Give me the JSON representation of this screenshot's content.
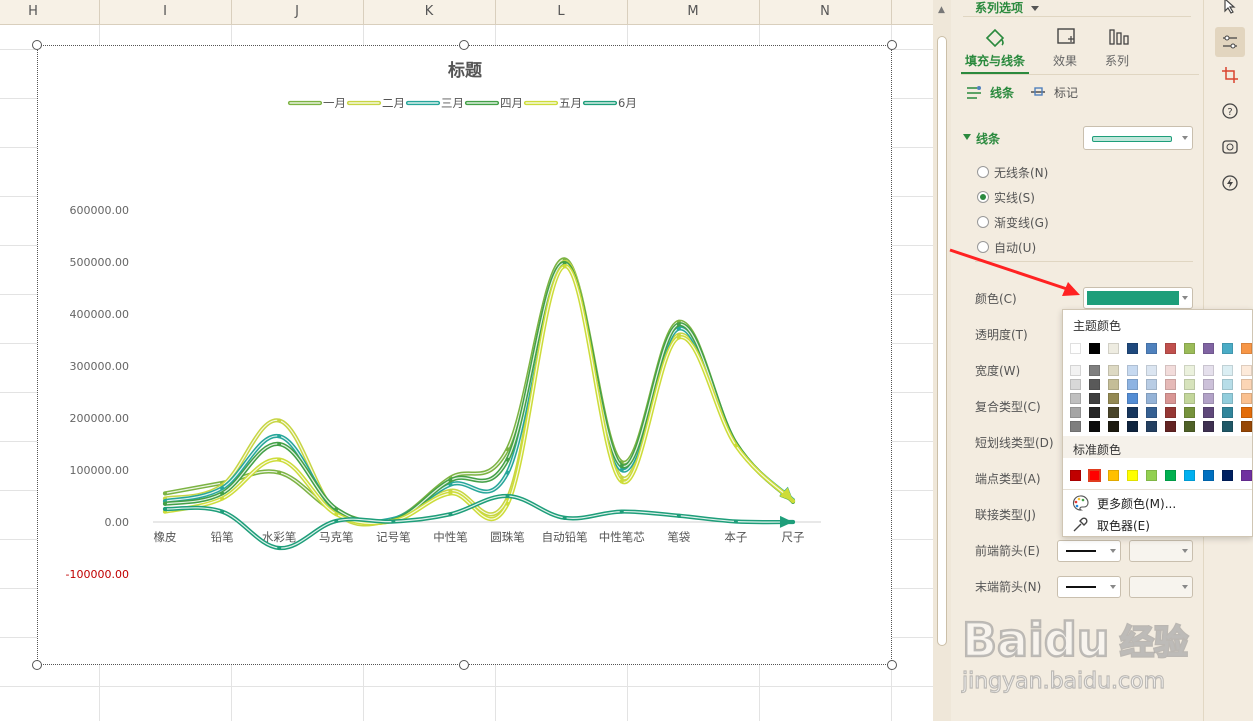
{
  "sheet": {
    "columns": [
      "H",
      "I",
      "J",
      "K",
      "L",
      "M",
      "N"
    ]
  },
  "chart": {
    "title": "标题"
  },
  "chart_data": {
    "type": "line",
    "title": "标题",
    "categories": [
      "橡皮",
      "铅笔",
      "水彩笔",
      "马克笔",
      "记号笔",
      "中性笔",
      "圆珠笔",
      "自动铅笔",
      "中性笔芯",
      "笔袋",
      "本子",
      "尺子"
    ],
    "ylim": [
      -100000,
      600000
    ],
    "yticks": [
      "600000.00",
      "500000.00",
      "400000.00",
      "300000.00",
      "200000.00",
      "100000.00",
      "0.00",
      "-100000.00"
    ],
    "grid": false,
    "legend_position": "top",
    "series": [
      {
        "name": "一月",
        "color": "#7cb342",
        "values": [
          55000,
          75000,
          95000,
          20000,
          5000,
          85000,
          140000,
          505000,
          115000,
          385000,
          150000,
          40000
        ]
      },
      {
        "name": "二月",
        "color": "#c7d543",
        "values": [
          45000,
          70000,
          195000,
          18000,
          4000,
          60000,
          45000,
          500000,
          85000,
          360000,
          148000,
          41000
        ]
      },
      {
        "name": "三月",
        "color": "#26a69a",
        "values": [
          40000,
          65000,
          165000,
          22000,
          6000,
          72000,
          95000,
          495000,
          100000,
          372000,
          149000,
          42000
        ]
      },
      {
        "name": "四月",
        "color": "#43a047",
        "values": [
          35000,
          55000,
          150000,
          25000,
          3000,
          80000,
          120000,
          498000,
          108000,
          380000,
          151000,
          39000
        ]
      },
      {
        "name": "五月",
        "color": "#cddc39",
        "values": [
          20000,
          45000,
          120000,
          15000,
          2000,
          55000,
          35000,
          492000,
          78000,
          355000,
          147000,
          40500
        ]
      },
      {
        "name": "6月",
        "color": "#1e9e7a",
        "values": [
          25000,
          20000,
          -50000,
          2000,
          1000,
          15000,
          50000,
          8000,
          20000,
          12000,
          1000,
          0
        ]
      }
    ]
  },
  "panel": {
    "header_label": "系列选项",
    "tabs": [
      "填充与线条",
      "效果",
      "系列"
    ],
    "subtabs": [
      "线条",
      "标记"
    ],
    "section_title": "线条",
    "radio_options": [
      "无线条(N)",
      "实线(S)",
      "渐变线(G)",
      "自动(U)"
    ],
    "selected_radio": 1,
    "properties": [
      "颜色(C)",
      "透明度(T)",
      "宽度(W)",
      "复合类型(C)",
      "短划线类型(D)",
      "端点类型(A)",
      "联接类型(J)",
      "前端箭头(E)",
      "末端箭头(N)"
    ],
    "selected_color": "#1e9e7a"
  },
  "color_popup": {
    "theme_title": "主题颜色",
    "standard_title": "标准颜色",
    "theme_top": [
      "#ffffff",
      "#000000",
      "#eeece1",
      "#1f497d",
      "#4f81bd",
      "#c0504d",
      "#9bbb59",
      "#8064a2",
      "#4bacc6",
      "#f79646"
    ],
    "theme_shades": [
      [
        "#f2f2f2",
        "#7f7f7f",
        "#ddd9c3",
        "#c6d9f0",
        "#dbe5f1",
        "#f2dcdb",
        "#ebf1dd",
        "#e5e0ec",
        "#dbeef3",
        "#fdeada"
      ],
      [
        "#d8d8d8",
        "#595959",
        "#c4bd97",
        "#8db3e2",
        "#b8cce4",
        "#e5b9b7",
        "#d7e3bc",
        "#ccc1d9",
        "#b7dde8",
        "#fbd5b5"
      ],
      [
        "#bfbfbf",
        "#3f3f3f",
        "#938953",
        "#548dd4",
        "#95b3d7",
        "#d99694",
        "#c3d69b",
        "#b2a2c7",
        "#92cddc",
        "#fac08f"
      ],
      [
        "#a5a5a5",
        "#262626",
        "#494429",
        "#17365d",
        "#366092",
        "#953734",
        "#76923c",
        "#5f497a",
        "#31859b",
        "#e36c09"
      ],
      [
        "#7f7f7f",
        "#0c0c0c",
        "#1d1b10",
        "#0f243e",
        "#244061",
        "#632423",
        "#4f6128",
        "#3f3151",
        "#205867",
        "#974806"
      ]
    ],
    "standard": [
      "#c00000",
      "#ff0000",
      "#ffc000",
      "#ffff00",
      "#92d050",
      "#00b050",
      "#00b0f0",
      "#0070c0",
      "#002060",
      "#7030a0"
    ],
    "standard_selected": 1,
    "more_colors": "更多颜色(M)...",
    "eyedropper": "取色器(E)"
  },
  "watermark": {
    "brand": "Baidu",
    "jingyan": "经验",
    "url": "jingyan.baidu.com"
  },
  "icons": [
    "cursor-icon",
    "settings-sliders-icon",
    "crop-icon",
    "help-icon",
    "style-icon",
    "lightning-icon",
    "fill-line-icon",
    "effects-icon",
    "series-icon",
    "line-icon",
    "marker-icon",
    "palette-icon",
    "eyedropper-icon"
  ]
}
